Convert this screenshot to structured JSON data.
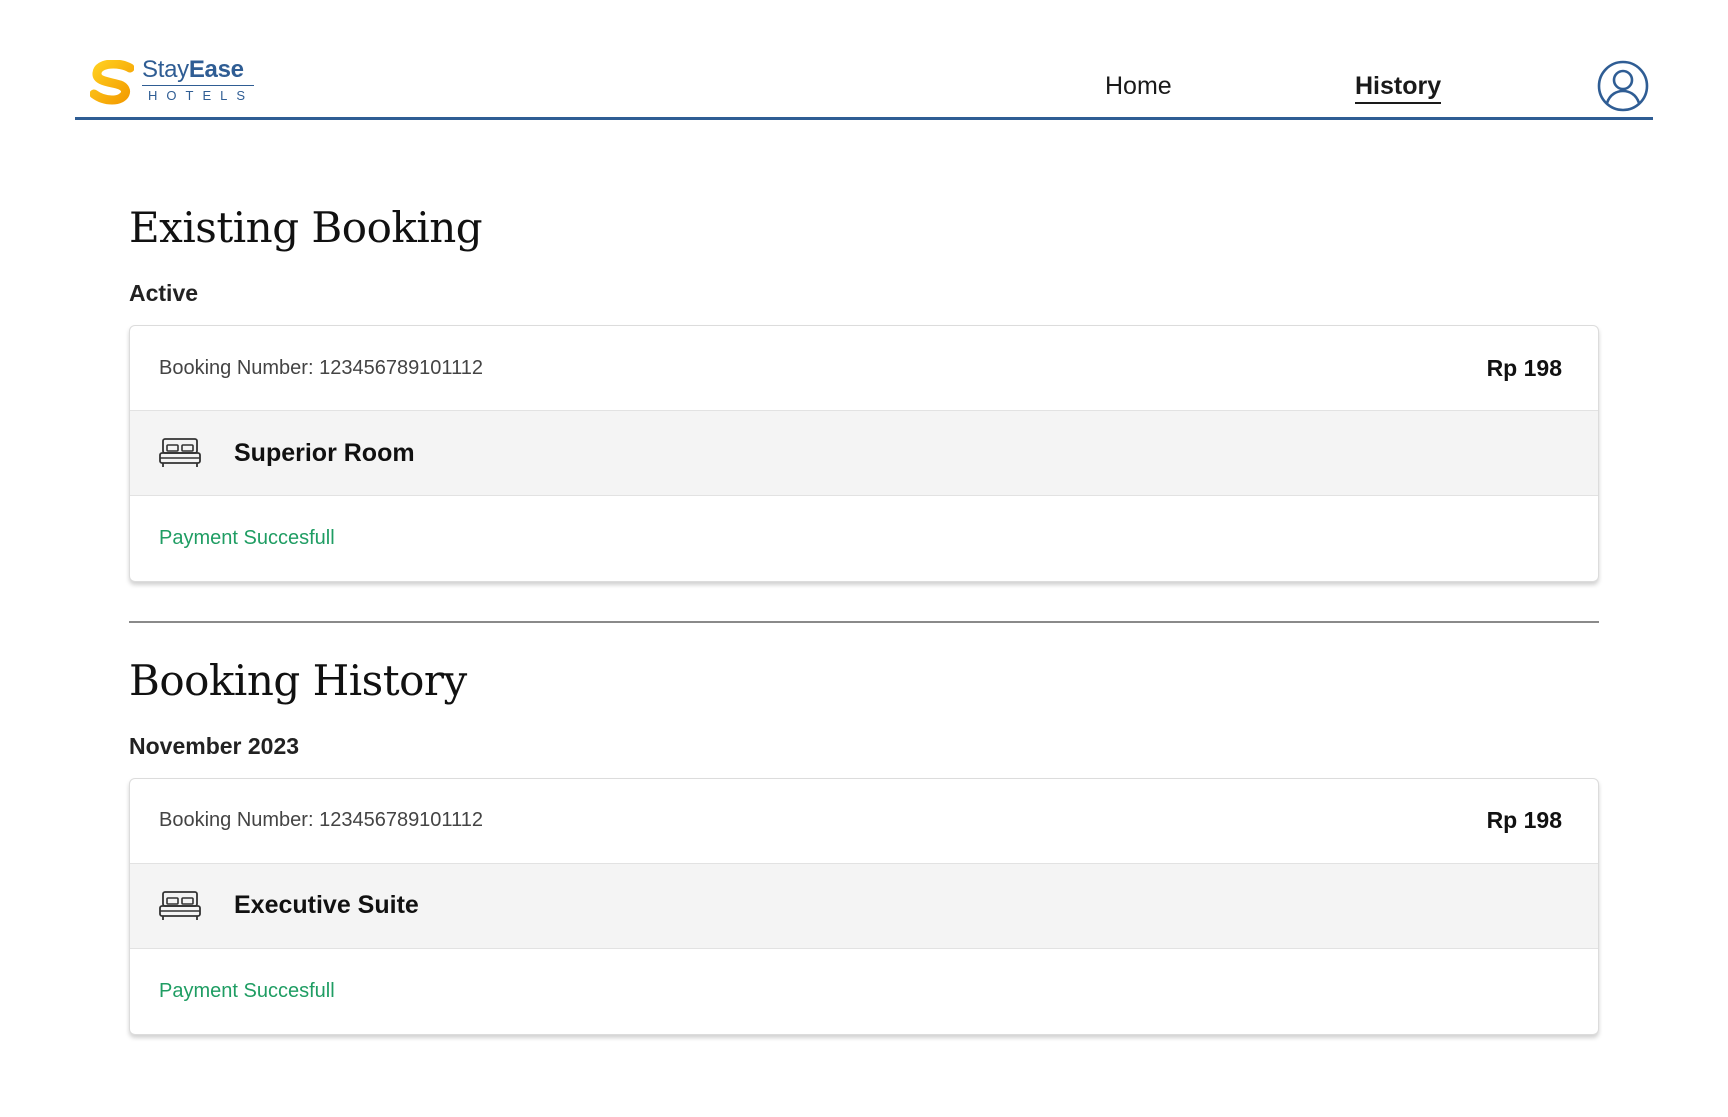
{
  "brand": {
    "name_part1": "Stay",
    "name_part2": "Ease",
    "subtitle": "HOTELS",
    "primary_color": "#2f5d94",
    "accent_color": "#f5b400"
  },
  "nav": {
    "home_label": "Home",
    "history_label": "History",
    "active": "History"
  },
  "existing": {
    "title": "Existing Booking",
    "group_label": "Active",
    "booking": {
      "number_label": "Booking Number: 123456789101112",
      "price": "Rp 198",
      "room": "Superior Room",
      "status": "Payment Succesfull"
    }
  },
  "history": {
    "title": "Booking History",
    "group_label": "November 2023",
    "booking": {
      "number_label": "Booking Number: 123456789101112",
      "price": "Rp 198",
      "room": "Executive Suite",
      "status": "Payment Succesfull"
    }
  },
  "colors": {
    "status_success": "#1f9d63",
    "room_row_bg": "#f4f4f4"
  }
}
